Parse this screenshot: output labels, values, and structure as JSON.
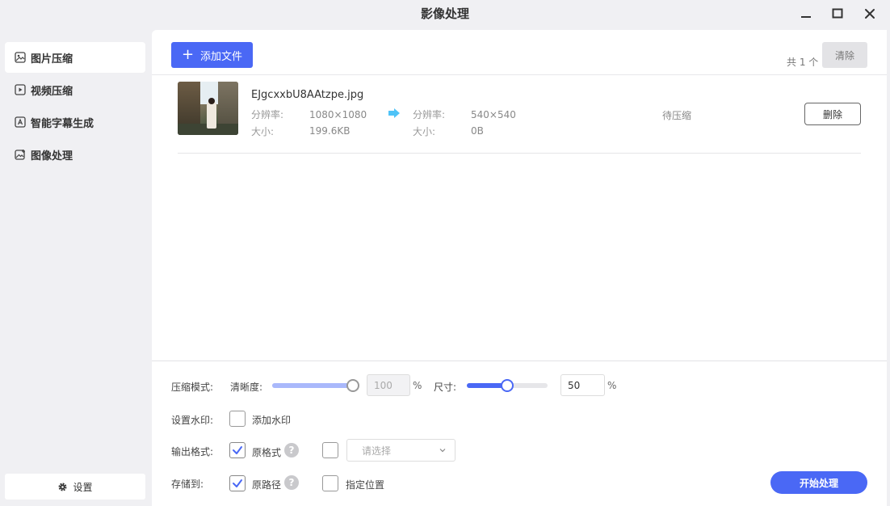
{
  "window": {
    "title": "影像处理",
    "controls": [
      "minimize-icon",
      "maximize-icon",
      "close-icon"
    ]
  },
  "sidebar": {
    "items": [
      {
        "label": "图片压缩",
        "icon": "image-icon",
        "active": true
      },
      {
        "label": "视频压缩",
        "icon": "video-icon",
        "active": false
      },
      {
        "label": "智能字幕生成",
        "icon": "subtitle-icon",
        "active": false
      },
      {
        "label": "图像处理",
        "icon": "image-edit-icon",
        "active": false
      }
    ],
    "settings_label": "设置"
  },
  "toolbar": {
    "add_file_label": "添加文件",
    "count_text": "共 1 个",
    "clear_label": "清除"
  },
  "files": [
    {
      "name": "EJgcxxbU8AAtzpe.jpg",
      "resolution_label": "分辨率:",
      "size_label": "大小:",
      "original_resolution": "1080×1080",
      "original_size": "199.6KB",
      "target_resolution": "540×540",
      "target_size": "0B",
      "status": "待压缩",
      "delete_label": "删除"
    }
  ],
  "options": {
    "compress_mode_label": "压缩模式:",
    "clarity_label": "清晰度:",
    "clarity_value": "100",
    "clarity_fraction": 1.0,
    "size_label": "尺寸:",
    "size_value": "50",
    "size_fraction": 0.5,
    "percent_sign": "%",
    "watermark_label": "设置水印:",
    "add_watermark_label": "添加水印",
    "add_watermark_checked": false,
    "output_format_label": "输出格式:",
    "original_format_label": "原格式",
    "original_format_checked": true,
    "custom_format_checked": false,
    "format_select_placeholder": "请选择",
    "save_to_label": "存储到:",
    "original_path_label": "原路径",
    "original_path_checked": true,
    "custom_location_label": "指定位置",
    "custom_location_checked": false,
    "help_glyph": "?"
  },
  "start_label": "开始处理",
  "colors": {
    "accent": "#4a68f5",
    "arrow": "#4fc3f7"
  }
}
